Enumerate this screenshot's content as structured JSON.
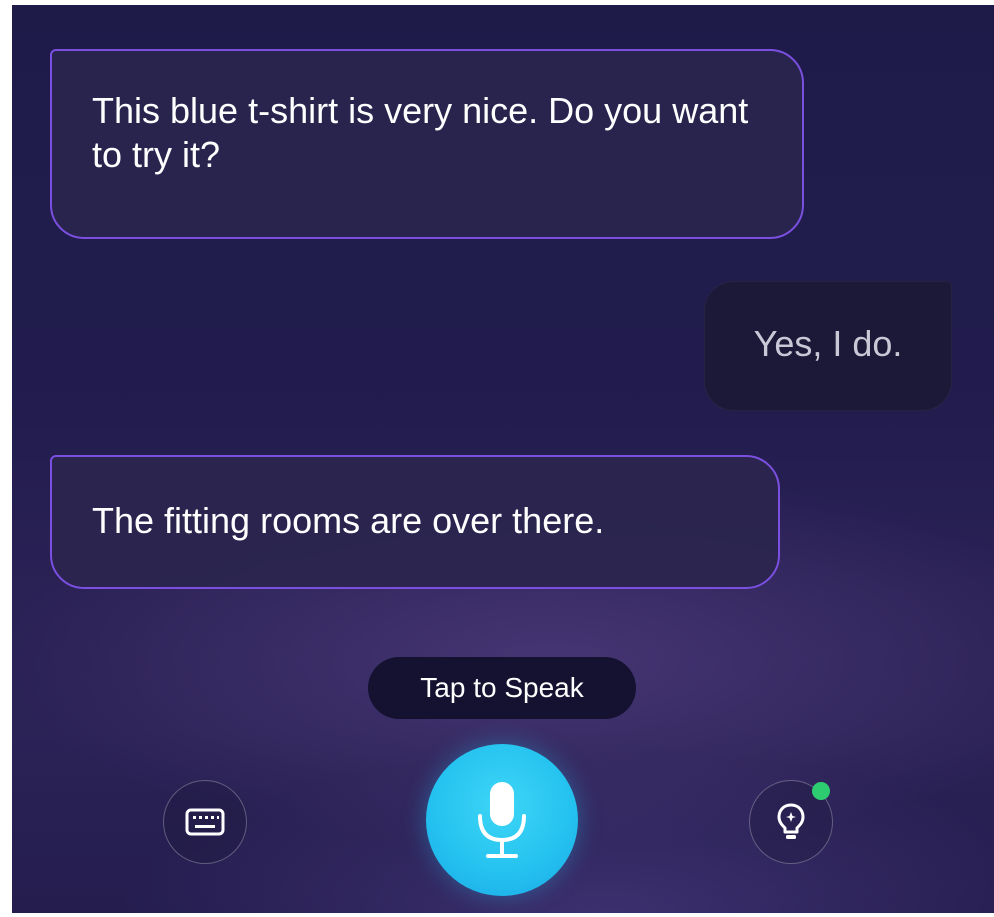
{
  "conversation": {
    "messages": [
      {
        "role": "bot",
        "text": "This blue t-shirt is very nice. Do you want to try it?"
      },
      {
        "role": "user",
        "text": "Yes, I do."
      },
      {
        "role": "bot",
        "text": "The fitting rooms are over there."
      }
    ]
  },
  "controls": {
    "tap_hint": "Tap to Speak",
    "keyboard_icon": "keyboard-icon",
    "mic_icon": "microphone-icon",
    "hint_icon": "lightbulb-icon",
    "hint_has_notification": true
  },
  "colors": {
    "bot_border": "#7b4fe0",
    "mic_button": "#25c3f0",
    "notification_dot": "#2ecc71",
    "background": "#211c4d"
  }
}
